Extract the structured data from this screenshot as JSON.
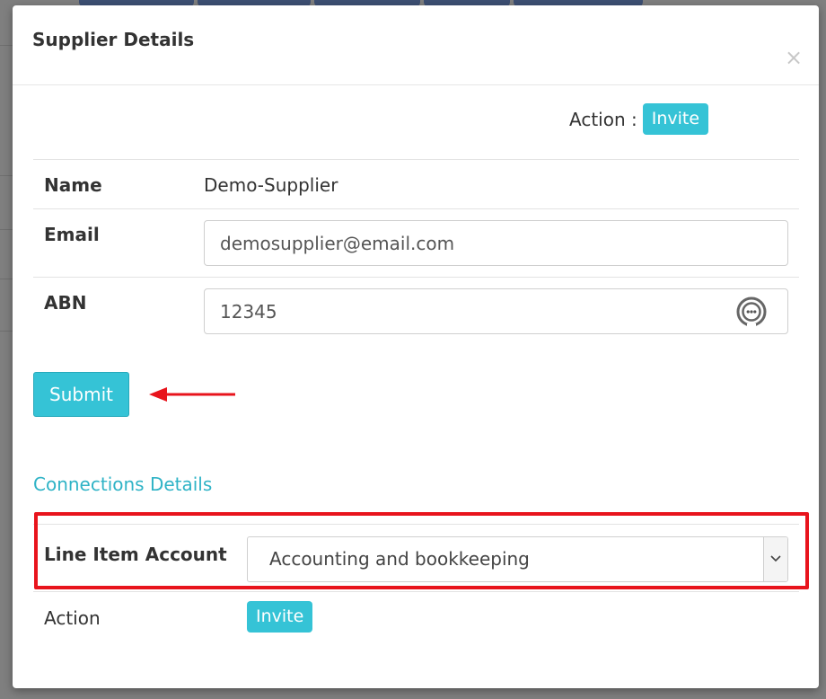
{
  "modal": {
    "title": "Supplier Details",
    "close_symbol": "×"
  },
  "header_action": {
    "label": "Action :",
    "badge": "Invite"
  },
  "details": {
    "name_label": "Name",
    "name_value": "Demo-Supplier",
    "email_label": "Email",
    "email_value": "demosupplier@email.com",
    "abn_label": "ABN",
    "abn_value": "12345"
  },
  "submit_label": "Submit",
  "connections": {
    "title": "Connections Details",
    "line_item_label": "Line Item Account",
    "line_item_value": "Accounting and bookkeeping",
    "action_label": "Action",
    "action_badge": "Invite"
  },
  "icons": {
    "close": "close-icon",
    "abn_field": "password-manager-icon",
    "select_caret": "chevron-down-icon",
    "annotation_arrow": "arrow-left-icon"
  },
  "colors": {
    "accent": "#35c3d6",
    "section_title": "#2fb3c6",
    "annotation": "#e8141c",
    "overlay": "#7f7f7f"
  }
}
